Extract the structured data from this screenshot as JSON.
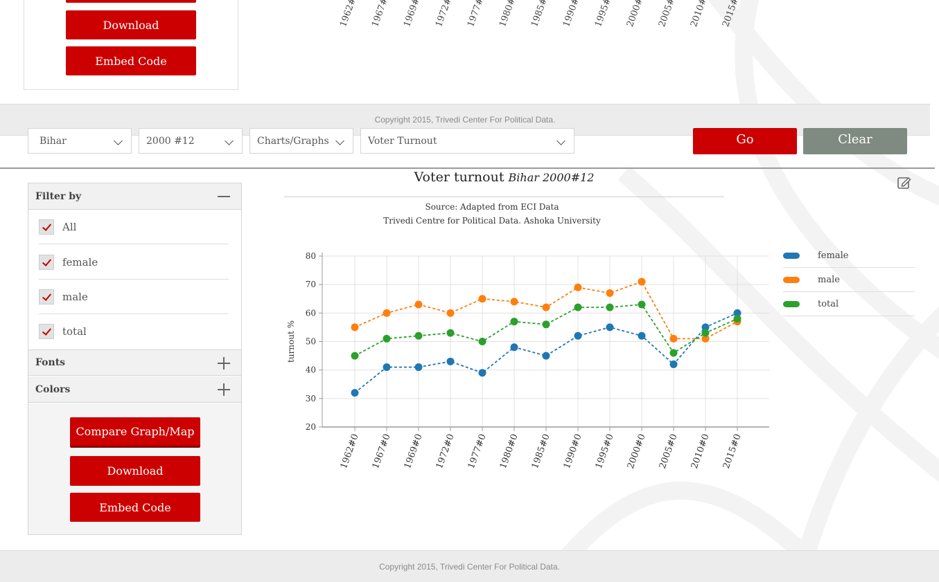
{
  "top_ghost": {
    "download_label": "Download",
    "embed_label": "Embed Code",
    "ticks": [
      "1962#",
      "1967#",
      "1969#",
      "1972#",
      "1977#",
      "1980#",
      "1985#",
      "1990#",
      "1995#",
      "2000#",
      "2005#",
      "2010#",
      "2015#"
    ]
  },
  "footer": {
    "copyright": "Copyright 2015, Trivedi Center For Political Data."
  },
  "selectors": {
    "state": "Bihar",
    "year": "2000 #12",
    "view": "Charts/Graphs",
    "variable": "Voter Turnout",
    "go_label": "Go",
    "clear_label": "Clear"
  },
  "sidebar": {
    "filter_title": "Filter by",
    "filters": [
      {
        "label": "All",
        "checked": true
      },
      {
        "label": "female",
        "checked": true
      },
      {
        "label": "male",
        "checked": true
      },
      {
        "label": "total",
        "checked": true
      }
    ],
    "fonts_title": "Fonts",
    "colors_title": "Colors",
    "compare_label": "Compare Graph/Map",
    "download_label": "Download",
    "embed_label": "Embed Code"
  },
  "chart_header": {
    "title": "Voter turnout",
    "title_sub": "Bihar 2000#12",
    "source_line1": "Source: Adapted from ECI Data",
    "source_line2": "Trivedi Centre for Political Data. Ashoka University"
  },
  "colors": {
    "brand_red": "#cc0000",
    "clear_grey": "#7f8a80",
    "female": "#1f77b4",
    "male": "#ff7f0e",
    "total": "#2ca02c"
  },
  "chart_data": {
    "type": "line",
    "title": "Voter turnout",
    "ylabel": "turnout %",
    "xlabel": "",
    "ylim": [
      20,
      80
    ],
    "yticks": [
      20,
      30,
      40,
      50,
      60,
      70,
      80
    ],
    "grid": true,
    "legend_position": "right",
    "categories": [
      "1962#0",
      "1967#0",
      "1969#0",
      "1972#0",
      "1977#0",
      "1980#0",
      "1985#0",
      "1990#0",
      "1995#0",
      "2000#0",
      "2005#0",
      "2010#0",
      "2015#0"
    ],
    "series": [
      {
        "name": "female",
        "color": "#1f77b4",
        "values": [
          32,
          41,
          41,
          43,
          39,
          48,
          45,
          52,
          55,
          52,
          42,
          55,
          60
        ]
      },
      {
        "name": "male",
        "color": "#ff7f0e",
        "values": [
          55,
          60,
          63,
          60,
          65,
          64,
          62,
          69,
          67,
          71,
          51,
          51,
          57
        ]
      },
      {
        "name": "total",
        "color": "#2ca02c",
        "values": [
          45,
          51,
          52,
          53,
          50,
          57,
          56,
          62,
          62,
          63,
          46,
          53,
          58
        ]
      }
    ]
  }
}
